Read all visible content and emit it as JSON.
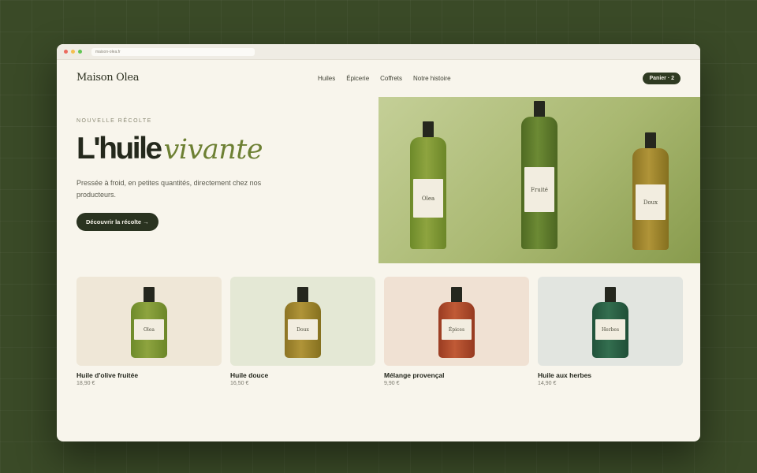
{
  "browser": {
    "url": "maison-olea.fr"
  },
  "nav": {
    "brand": "Maison Olea",
    "links": [
      "Huiles",
      "Épicerie",
      "Coffrets",
      "Notre histoire"
    ],
    "cart_label": "Panier · 2"
  },
  "hero": {
    "eyebrow": "NOUVELLE RÉCOLTE",
    "title_main": "L'huile",
    "title_accent": "vivante",
    "lead": "Pressée à froid, en petites quantités, directement chez nos producteurs.",
    "cta": "Découvrir la récolte →",
    "bottle_labels": [
      "Olea",
      "Fruité",
      "Doux"
    ]
  },
  "products": [
    {
      "name": "Huile d'olive fruitée",
      "price": "18,90 €",
      "label": "Olea"
    },
    {
      "name": "Huile douce",
      "price": "16,50 €",
      "label": "Doux"
    },
    {
      "name": "Mélange provençal",
      "price": "9,90 €",
      "label": "Épices"
    },
    {
      "name": "Huile aux herbes",
      "price": "14,90 €",
      "label": "Herbes"
    }
  ],
  "colors": {
    "background": "#3a4a27",
    "page": "#f8f5ec",
    "accent": "#6d8033",
    "dark": "#2a3320"
  }
}
